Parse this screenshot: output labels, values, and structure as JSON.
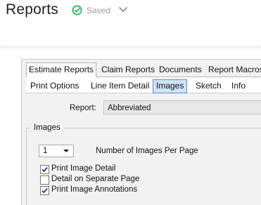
{
  "header": {
    "title": "Reports",
    "status": "Saved",
    "status_color": "#3cb371"
  },
  "tabs_primary": [
    {
      "label": "Estimate Reports",
      "active": true
    },
    {
      "label": "Claim Reports",
      "active": false
    },
    {
      "label": "Documents",
      "active": false
    },
    {
      "label": "Report Macros",
      "active": false
    }
  ],
  "tabs_secondary": [
    {
      "label": "Print Options",
      "active": false
    },
    {
      "label": "Line Item Detail",
      "active": false
    },
    {
      "label": "Images",
      "active": true
    },
    {
      "label": "Sketch",
      "active": false
    },
    {
      "label": "Info",
      "active": false
    }
  ],
  "report": {
    "label": "Report:",
    "value": "Abbreviated"
  },
  "images_group": {
    "title": "Images",
    "count_value": "1",
    "count_label": "Number of Images Per Page",
    "options": [
      {
        "label": "Print Image Detail",
        "checked": true
      },
      {
        "label": "Detail on Separate Page",
        "checked": false
      },
      {
        "label": "Print Image Annotations",
        "checked": true
      }
    ]
  },
  "icons": {
    "saved": "check-circle-icon",
    "expand": "chevron-down-icon"
  }
}
